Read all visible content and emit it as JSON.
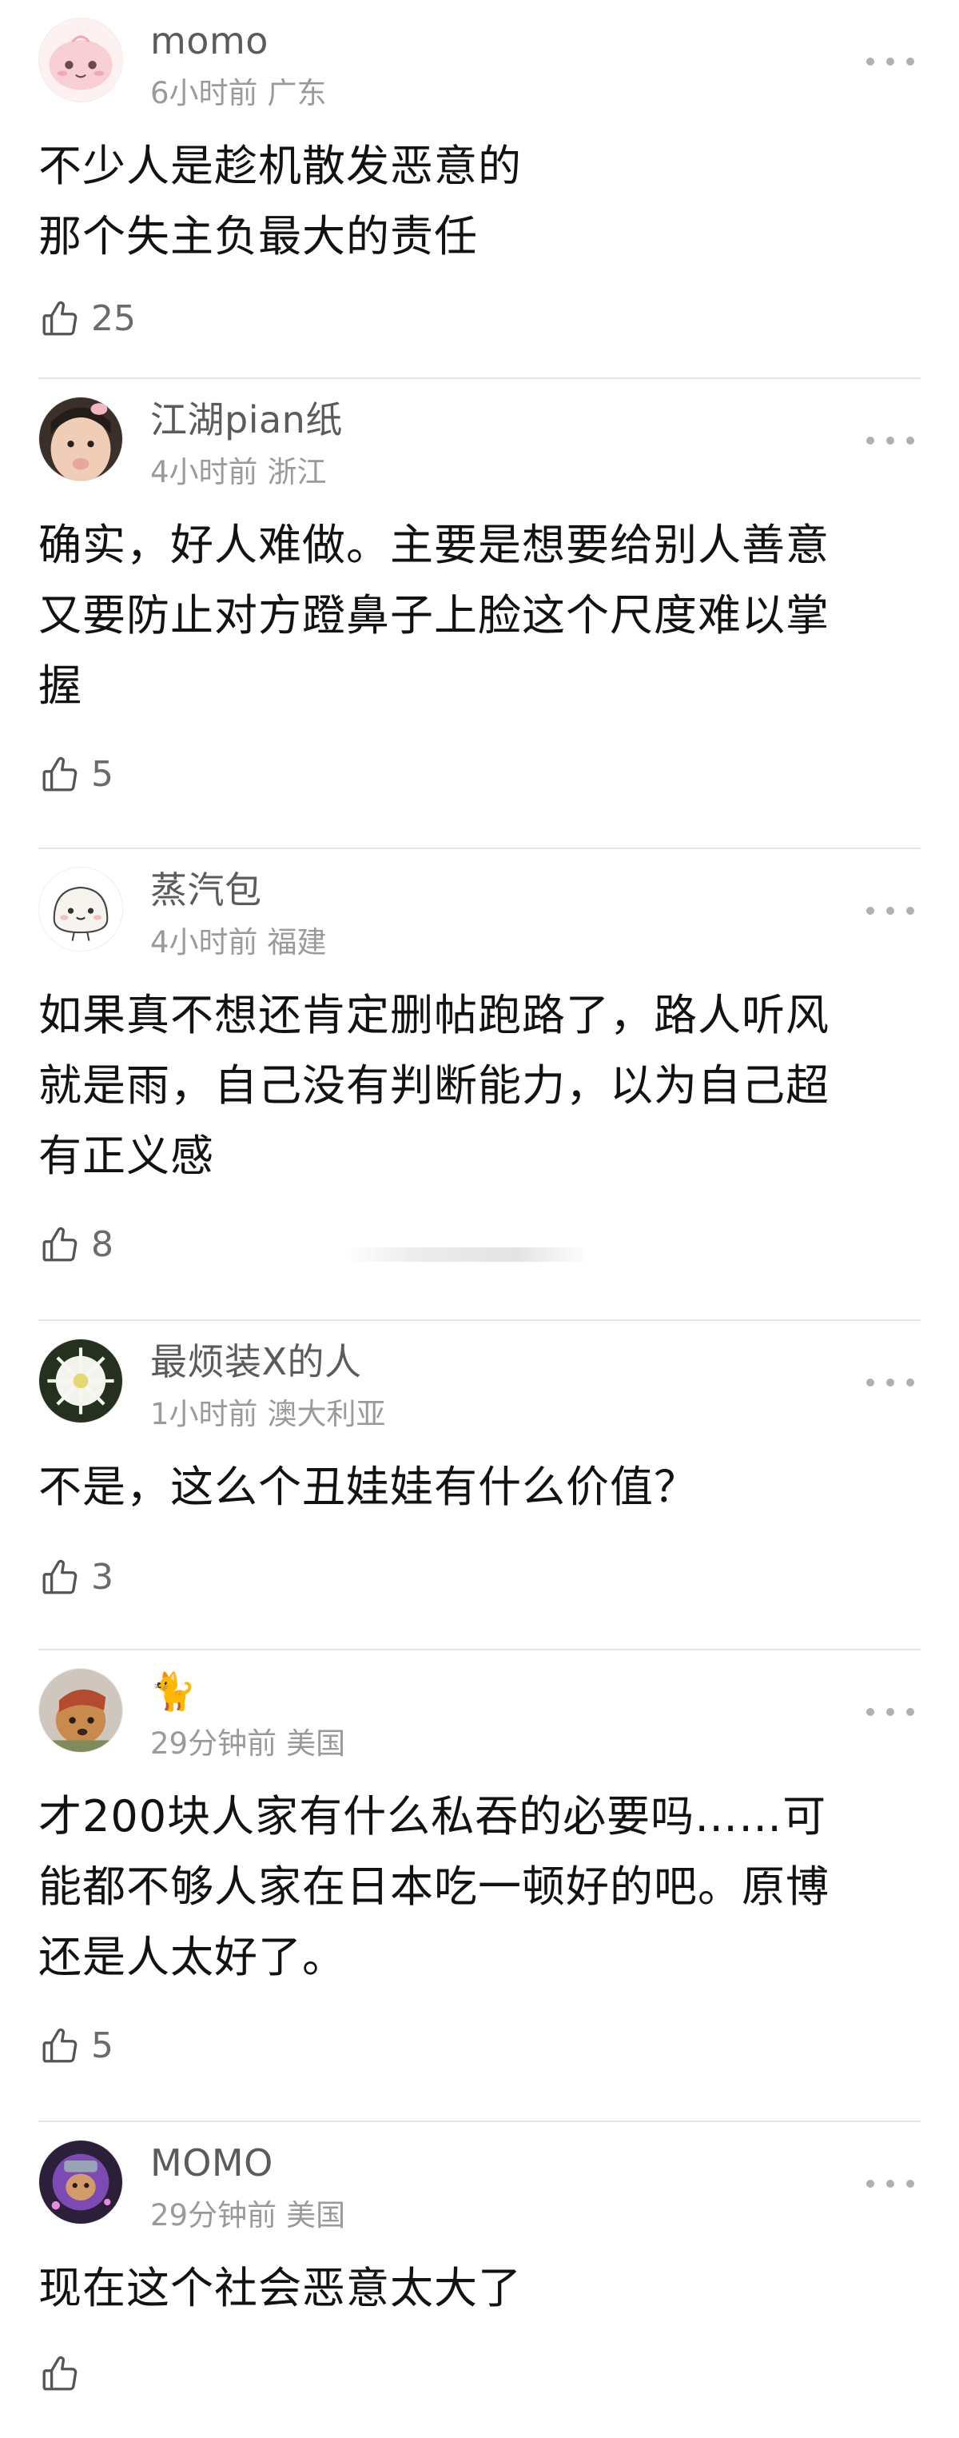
{
  "comments": [
    {
      "username": "momo",
      "time": "6小时前",
      "location": "广东",
      "lines": [
        "不少人是趁机散发恶意的",
        "那个失主负最大的责任"
      ],
      "likes": "25",
      "avatar": "pink-bun-avatar"
    },
    {
      "username": "江湖pian纸",
      "time": "4小时前",
      "location": "浙江",
      "lines": [
        "确实，好人难做。主要是想要给别人善意",
        "又要防止对方蹬鼻子上脸这个尺度难以掌",
        "握"
      ],
      "likes": "5",
      "avatar": "baby-photo-avatar"
    },
    {
      "username": "蒸汽包",
      "time": "4小时前",
      "location": "福建",
      "lines": [
        "如果真不想还肯定删帖跑路了，路人听风",
        "就是雨，自己没有判断能力，以为自己超",
        "有正义感"
      ],
      "likes": "8",
      "avatar": "steamed-bun-avatar"
    },
    {
      "username": "最烦装X的人",
      "time": "1小时前",
      "location": "澳大利亚",
      "lines": [
        "不是，这么个丑娃娃有什么价值？"
      ],
      "likes": "3",
      "avatar": "flower-photo-avatar"
    },
    {
      "username": "🐈",
      "time": "29分钟前",
      "location": "美国",
      "lines": [
        "才200块人家有什么私吞的必要吗……可",
        "能都不够人家在日本吃一顿好的吧。原博",
        "还是人太好了。"
      ],
      "likes": "5",
      "avatar": "dog-photo-avatar"
    },
    {
      "username": "MOMO",
      "time": "29分钟前",
      "location": "美国",
      "lines": [
        "现在这个社会恶意太大了"
      ],
      "likes": "",
      "avatar": "purple-character-avatar"
    }
  ],
  "icons": {
    "like": "thumbs-up-icon",
    "more": "more-dots-icon"
  },
  "colors": {
    "name": "#5b5b5b",
    "meta": "#9a9a9a",
    "text": "#121212",
    "divider": "#e6e6e6"
  }
}
